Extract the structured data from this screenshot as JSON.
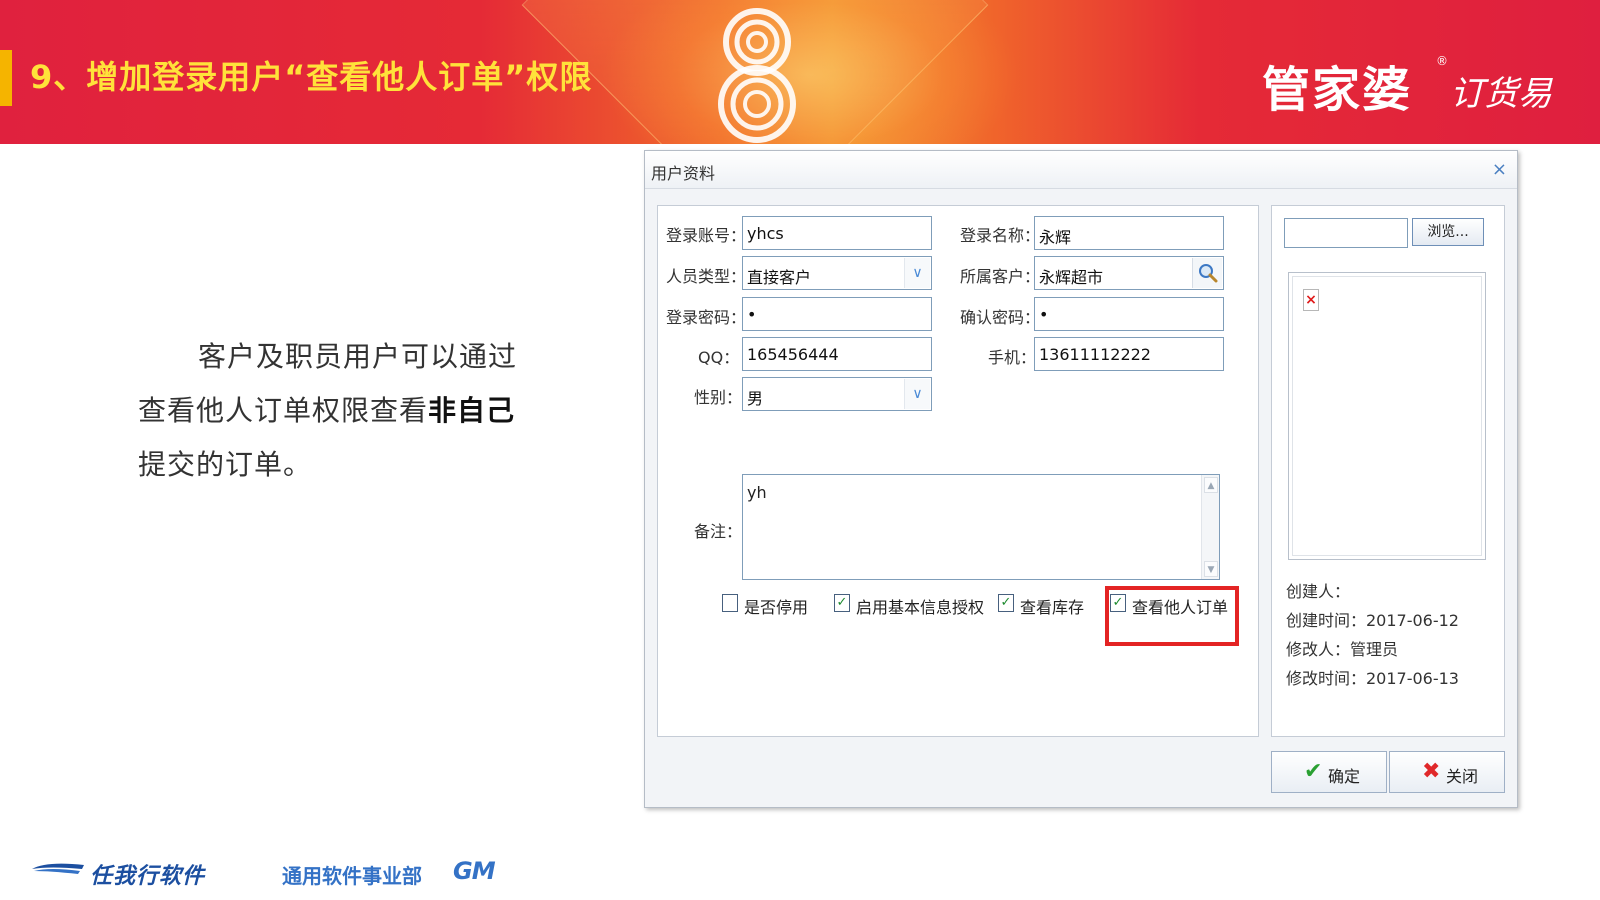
{
  "slide": {
    "title": "9、增加登录用户“查看他人订单”权限",
    "brand": "管家婆",
    "brand_reg": "®",
    "brand_sub": "订货易",
    "description": {
      "line1": "客户及职员用户可以通过",
      "line2_prefix": "查看他人订单权限查看",
      "line2_bold": "非自己",
      "line3": "提交的订单。"
    },
    "footer": {
      "company": "任我行软件",
      "dept": "通用软件事业部",
      "dept_short": "GM"
    },
    "colors": {
      "banner": "#e52a36",
      "title": "#ffe23a",
      "highlight": "#e32424",
      "footer_blue": "#3472c6"
    }
  },
  "dialog": {
    "title": "用户资料",
    "close_icon": "×",
    "form": {
      "login_account": {
        "label": "登录账号：",
        "value": "yhcs"
      },
      "login_name": {
        "label": "登录名称：",
        "value": "永辉"
      },
      "person_type": {
        "label": "人员类型：",
        "value": "直接客户"
      },
      "customer": {
        "label": "所属客户：",
        "value": "永辉超市"
      },
      "password": {
        "label": "登录密码：",
        "value": "•"
      },
      "confirm_password": {
        "label": "确认密码：",
        "value": "•"
      },
      "qq": {
        "label": "QQ：",
        "value": "165456444"
      },
      "phone": {
        "label": "手机：",
        "value": "13611112222"
      },
      "gender": {
        "label": "性别：",
        "value": "男"
      },
      "remark": {
        "label": "备注：",
        "value": "yh"
      }
    },
    "checkboxes": [
      {
        "label": "是否停用",
        "checked": false
      },
      {
        "label": "启用基本信息授权",
        "checked": true
      },
      {
        "label": "查看库存",
        "checked": true
      },
      {
        "label": "查看他人订单",
        "checked": true
      }
    ],
    "side": {
      "browse_label": "浏览...",
      "created_by": "创建人：",
      "created_time": "创建时间：2017-06-12",
      "modified_by": "修改人：管理员",
      "modified_time": "修改时间：2017-06-13"
    },
    "buttons": {
      "ok": "确定",
      "close": "关闭"
    }
  }
}
